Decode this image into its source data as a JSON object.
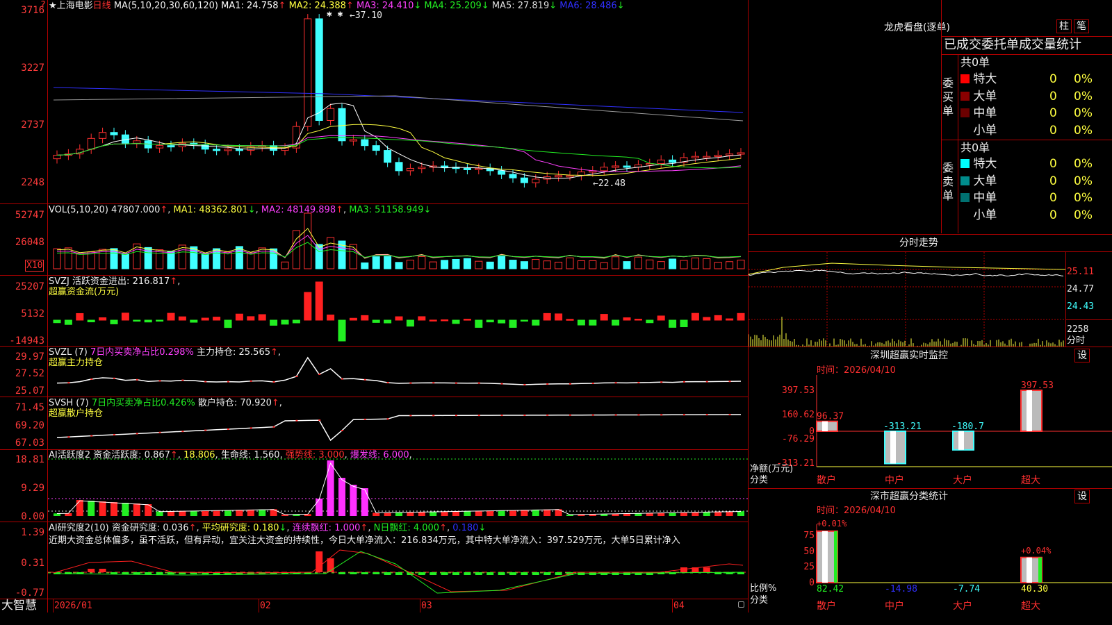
{
  "stock": {
    "star": "★",
    "name": "上海电影",
    "period": "日线",
    "ma_params": "MA(5,10,20,30,60,120)"
  },
  "ma": [
    {
      "name": "MA1:",
      "value": "24.758",
      "arrow": "↑",
      "color": "#ffffff"
    },
    {
      "name": "MA2:",
      "value": "24.388",
      "arrow": "↑",
      "color": "#ffff40"
    },
    {
      "name": "MA3:",
      "value": "24.410",
      "arrow": "↓",
      "color": "#ff40ff"
    },
    {
      "name": "MA4:",
      "value": "25.209",
      "arrow": "↓",
      "color": "#22ee22"
    },
    {
      "name": "MA5:",
      "value": "27.819",
      "arrow": "↓",
      "color": "#dddddd"
    },
    {
      "name": "MA6:",
      "value": "28.486",
      "arrow": "↓",
      "color": "#3030ff"
    }
  ],
  "price_axis": [
    "3716",
    "3227",
    "2737",
    "2248"
  ],
  "price_axis_top_mark": "?",
  "high_label": "37.10",
  "low_label": "22.48",
  "high_marks": "✱ ✱",
  "vol": {
    "params": "VOL(5,10,20)",
    "v": "47807.000",
    "v_arrow": "↑",
    "ma1": "MA1: 48362.801",
    "ma1_arrow": "↓",
    "ma2": "MA2: 48149.898",
    "ma2_arrow": "↑",
    "ma3": "MA3: 51158.949",
    "ma3_arrow": "↓",
    "axis": [
      "52747",
      "26048"
    ],
    "unit": "X10"
  },
  "svzj": {
    "label": "SVZJ",
    "item": "活跃资金进出:",
    "value": "216.817",
    "arrow": "↑",
    "comma": ",",
    "sub": "超赢资金流(万元)",
    "axis": [
      "25207",
      "5132",
      "-14943"
    ]
  },
  "svzl": {
    "label": "SVZL (7)",
    "pct": "7日内买卖净占比0.298%",
    "item": "主力持仓:",
    "value": "25.565",
    "arrow": "↑",
    "comma": ",",
    "sub": "超赢主力持仓",
    "axis": [
      "29.97",
      "27.52",
      "25.07"
    ]
  },
  "svsh": {
    "label": "SVSH (7)",
    "pct": "7日内买卖净占比0.426%",
    "item": "散户持仓:",
    "value": "70.920",
    "arrow": "↑",
    "comma": ",",
    "sub": "超赢散户持仓",
    "axis": [
      "71.45",
      "69.20",
      "67.03"
    ]
  },
  "ai2": {
    "label": "AI活跃度2",
    "item": "资金活跃度:",
    "value": "0.867",
    "arrow": "↑",
    "v2": "18.806",
    "life": "生命线:",
    "life_v": "1.560",
    "strong": "强势线:",
    "strong_v": "3.000",
    "burst": "爆发线:",
    "burst_v": "6.000",
    "axis": [
      "18.81",
      "9.29",
      "0.00"
    ]
  },
  "air": {
    "label": "AI研究度2(10)",
    "item": "资金研究度:",
    "value": "0.036",
    "arrow": "↑",
    "avg": "平均研究度:",
    "avg_v": "0.180",
    "avg_arrow": "↓",
    "lx": "连续飘红:",
    "lx_v": "1.000",
    "lx_arrow": "↑",
    "nr": "N日飘红:",
    "nr_v": "4.000",
    "nr_arrow": "↑",
    "last": "0.180",
    "last_arrow": "↓",
    "text": "近期大资金总体偏多，虽不活跃，但有异动，宜关注大资金的持续性，今日大单净流入：216.834万元，其中特大单净流入：397.529万元，大单5日累计净入",
    "axis": [
      "1.39",
      "0.31",
      "-0.77"
    ]
  },
  "date_axis": [
    "2026/01",
    "02",
    "03",
    "04"
  ],
  "brand": "大智慧",
  "right": {
    "lhb_title": "龙虎看盘(逐单)",
    "btn1": "柱",
    "btn2": "笔",
    "stat_title": "已成交委托单成交量统计",
    "buy": {
      "side": "委买单",
      "total": "共0单",
      "rows": [
        {
          "label": "特大",
          "n": "0",
          "p": "0%",
          "color": "#ff0000"
        },
        {
          "label": "大单",
          "n": "0",
          "p": "0%",
          "color": "#8b0000"
        },
        {
          "label": "中单",
          "n": "0",
          "p": "0%",
          "color": "#6b0000"
        },
        {
          "label": "小单",
          "n": "0",
          "p": "0%",
          "color": "#000000"
        }
      ]
    },
    "sell": {
      "side": "委卖单",
      "total": "共0单",
      "rows": [
        {
          "label": "特大",
          "n": "0",
          "p": "0%",
          "color": "#00ffff"
        },
        {
          "label": "大单",
          "n": "0",
          "p": "0%",
          "color": "#008b8b"
        },
        {
          "label": "中单",
          "n": "0",
          "p": "0%",
          "color": "#007070"
        },
        {
          "label": "小单",
          "n": "0",
          "p": "0%",
          "color": "#000000"
        }
      ]
    },
    "ts_title": "分时走势",
    "ts_axis": [
      "25.11",
      "24.77",
      "24.43"
    ],
    "ts_vol": "2258",
    "ts_vol_unit": "分时",
    "mon_title": "深圳超赢实时监控",
    "set": "设",
    "mon_time": "时间：2026/04/10",
    "mon_axis": [
      "397.53",
      "160.62",
      "0",
      "-76.29",
      "-313.21"
    ],
    "mon_ylabel": "净额(万元)",
    "mon_xlabel": "分类",
    "mon_bars": [
      {
        "cat": "散户",
        "value": 96.37,
        "label": "96.37",
        "color": "#ff3030"
      },
      {
        "cat": "中户",
        "value": -313.21,
        "label": "-313.21",
        "color": "#40ffff"
      },
      {
        "cat": "大户",
        "value": -180.7,
        "label": "-180.7",
        "color": "#40ffff"
      },
      {
        "cat": "超大",
        "value": 397.53,
        "label": "397.53",
        "color": "#ff3030"
      }
    ],
    "cls_title": "深市超赢分类统计",
    "cls_time": "时间：2026/04/10",
    "cls_axis": [
      "75",
      "50",
      "25",
      "0"
    ],
    "cls_ylabel": "比例%",
    "cls_xlabel": "分类",
    "cls_top": [
      "+0.01%",
      "+0.04%"
    ],
    "cls_vals": [
      {
        "cat": "散户",
        "label": "82.42",
        "color": "#22ee22"
      },
      {
        "cat": "中户",
        "label": "-14.98",
        "color": "#3030ff"
      },
      {
        "cat": "大户",
        "label": "-7.74",
        "color": "#40ffff"
      },
      {
        "cat": "超大",
        "label": "40.30",
        "color": "#ffff40"
      }
    ]
  }
}
